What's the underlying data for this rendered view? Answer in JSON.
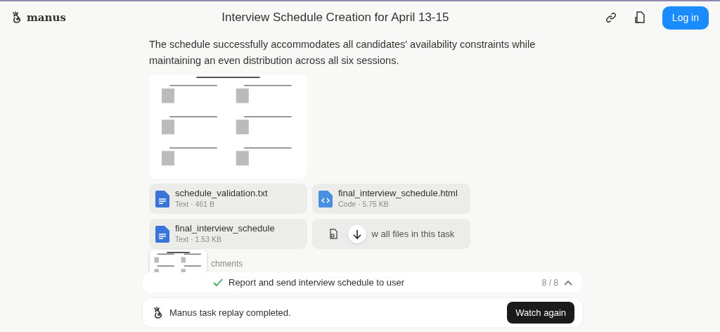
{
  "header": {
    "brand": "manus",
    "title": "Interview Schedule Creation for April 13-15",
    "login": "Log in"
  },
  "message": "The schedule successfully accommodates all candidates' availability constraints while maintaining an even distribution across all six sessions.",
  "files": [
    {
      "kind": "text",
      "name": "schedule_validation.txt",
      "meta": "Text · 461 B"
    },
    {
      "kind": "code",
      "name": "final_interview_schedule.html",
      "meta": "Code · 5.75 KB"
    },
    {
      "kind": "text",
      "name": "final_interview_schedule",
      "meta": "Text · 1.53 KB"
    }
  ],
  "view_all": "w all files in this task",
  "attachments_label": "chments",
  "step": {
    "label": "Report and send interview schedule to user",
    "done": true,
    "count": "8 / 8",
    "expanded": true
  },
  "replay": {
    "message": "Manus task replay completed.",
    "button": "Watch again"
  }
}
